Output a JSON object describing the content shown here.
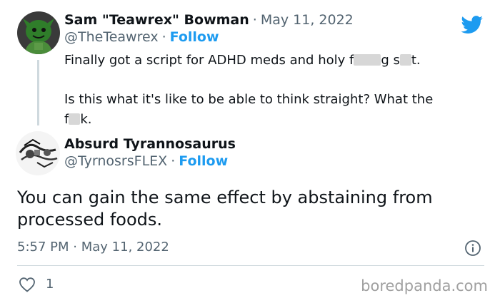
{
  "colors": {
    "link_blue": "#1d9bf0",
    "muted": "#536471",
    "text": "#0f1419",
    "divider": "#cfd9de"
  },
  "reply_tweet": {
    "display_name": "Sam \"Teawrex\" Bowman",
    "date_sep": "·",
    "date": "May 11, 2022",
    "handle": "@TheTeawrex",
    "follow_sep": "·",
    "follow_label": "Follow",
    "line1_a": "Finally got a script for ADHD meds and holy f",
    "line1_b": "g s",
    "line1_c": "t.",
    "line2": "Is this what it's like to be able to think straight? What the",
    "line3_a": "f",
    "line3_b": "k.",
    "avatar_icon": "avatar-green-creature",
    "brand_icon": "twitter-bird-icon"
  },
  "main_tweet": {
    "display_name": "Absurd Tyrannosaurus",
    "handle": "@TyrnosrsFLEX",
    "follow_sep": "·",
    "follow_label": "Follow",
    "text": "You can gain the same effect by abstaining from processed foods.",
    "time": "5:57 PM",
    "time_sep": "·",
    "date": "May 11, 2022",
    "like_count": "1",
    "avatar_icon": "avatar-sketch"
  },
  "watermark": "boredpanda.com"
}
